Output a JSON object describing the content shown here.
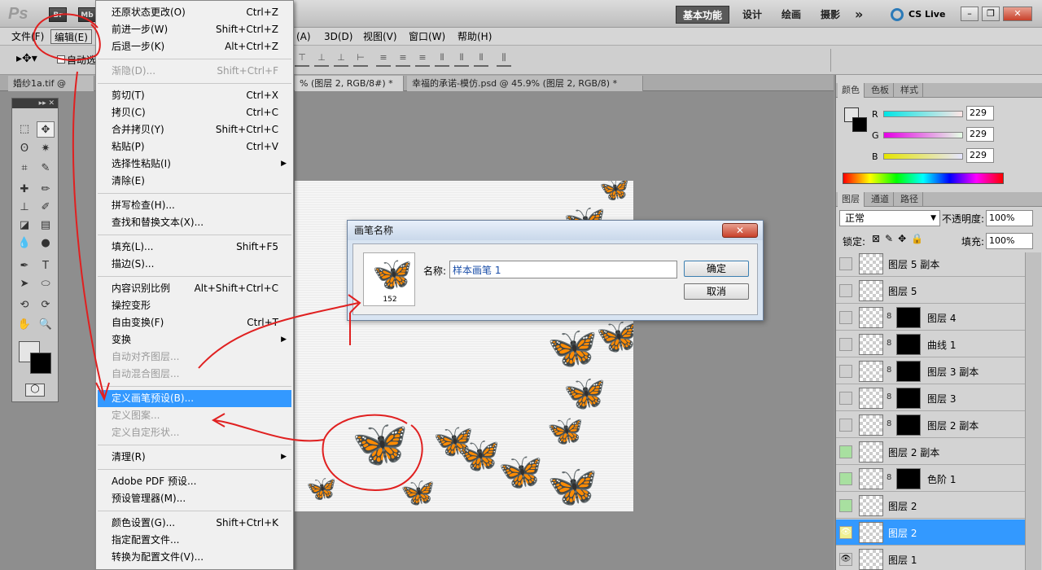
{
  "app": {
    "logo": "Ps",
    "bridge": "Br",
    "minibridge": "Mb",
    "workspaces": [
      "基本功能",
      "设计",
      "绘画",
      "摄影"
    ],
    "more": "»",
    "cslive": "CS Live"
  },
  "menubar": {
    "items": [
      "文件(F)",
      "编辑(E)",
      "(A)",
      "3D(D)",
      "视图(V)",
      "窗口(W)",
      "帮助(H)"
    ]
  },
  "options": {
    "auto_select": "自动选"
  },
  "tabs": [
    {
      "label": "婚纱1a.tif @ 12.5..."
    },
    {
      "label": "% (图层 2, RGB/8#) *"
    },
    {
      "label": "幸福的承诺-模仿.psd @ 45.9% (图层 2, RGB/8) *"
    }
  ],
  "edit_menu": [
    {
      "label": "还原状态更改(O)",
      "shortcut": "Ctrl+Z"
    },
    {
      "label": "前进一步(W)",
      "shortcut": "Shift+Ctrl+Z"
    },
    {
      "label": "后退一步(K)",
      "shortcut": "Alt+Ctrl+Z"
    },
    {
      "sep": true
    },
    {
      "label": "渐隐(D)...",
      "shortcut": "Shift+Ctrl+F",
      "disabled": true
    },
    {
      "sep": true
    },
    {
      "label": "剪切(T)",
      "shortcut": "Ctrl+X"
    },
    {
      "label": "拷贝(C)",
      "shortcut": "Ctrl+C"
    },
    {
      "label": "合并拷贝(Y)",
      "shortcut": "Shift+Ctrl+C"
    },
    {
      "label": "粘贴(P)",
      "shortcut": "Ctrl+V"
    },
    {
      "label": "选择性粘贴(I)",
      "submenu": true
    },
    {
      "label": "清除(E)"
    },
    {
      "sep": true
    },
    {
      "label": "拼写检查(H)..."
    },
    {
      "label": "查找和替换文本(X)..."
    },
    {
      "sep": true
    },
    {
      "label": "填充(L)...",
      "shortcut": "Shift+F5"
    },
    {
      "label": "描边(S)..."
    },
    {
      "sep": true
    },
    {
      "label": "内容识别比例",
      "shortcut": "Alt+Shift+Ctrl+C"
    },
    {
      "label": "操控变形"
    },
    {
      "label": "自由变换(F)",
      "shortcut": "Ctrl+T"
    },
    {
      "label": "变换",
      "submenu": true
    },
    {
      "label": "自动对齐图层...",
      "disabled": true
    },
    {
      "label": "自动混合图层...",
      "disabled": true
    },
    {
      "sep": true
    },
    {
      "label": "定义画笔预设(B)...",
      "highlighted": true
    },
    {
      "label": "定义图案...",
      "disabled": true
    },
    {
      "label": "定义自定形状...",
      "disabled": true
    },
    {
      "sep": true
    },
    {
      "label": "清理(R)",
      "submenu": true
    },
    {
      "sep": true
    },
    {
      "label": "Adobe PDF 预设..."
    },
    {
      "label": "预设管理器(M)..."
    },
    {
      "sep": true
    },
    {
      "label": "颜色设置(G)...",
      "shortcut": "Shift+Ctrl+K"
    },
    {
      "label": "指定配置文件..."
    },
    {
      "label": "转换为配置文件(V)..."
    }
  ],
  "dialog": {
    "title": "画笔名称",
    "brush_size": "152",
    "name_label": "名称:",
    "name_value": "样本画笔 1",
    "ok": "确定",
    "cancel": "取消"
  },
  "color_panel": {
    "tabs": [
      "颜色",
      "色板",
      "样式"
    ],
    "r_label": "R",
    "g_label": "G",
    "b_label": "B",
    "r": "229",
    "g": "229",
    "b": "229"
  },
  "layers_panel": {
    "tabs": [
      "图层",
      "通道",
      "路径"
    ],
    "blend_mode": "正常",
    "opacity_label": "不透明度:",
    "opacity": "100%",
    "lock_label": "锁定:",
    "fill_label": "填充:",
    "fill": "100%",
    "layers": [
      {
        "name": "图层 5 副本"
      },
      {
        "name": "图层 5"
      },
      {
        "name": "图层 4",
        "mask": true
      },
      {
        "name": "曲线 1",
        "mask": true
      },
      {
        "name": "图层 3 副本",
        "mask": true
      },
      {
        "name": "图层 3",
        "mask": true
      },
      {
        "name": "图层 2 副本",
        "mask": true
      },
      {
        "name": "图层 2 副本"
      },
      {
        "name": "色阶 1",
        "mask": true
      },
      {
        "name": "图层 2"
      },
      {
        "name": "图层 2",
        "selected": true
      },
      {
        "name": "图层 1"
      }
    ]
  }
}
